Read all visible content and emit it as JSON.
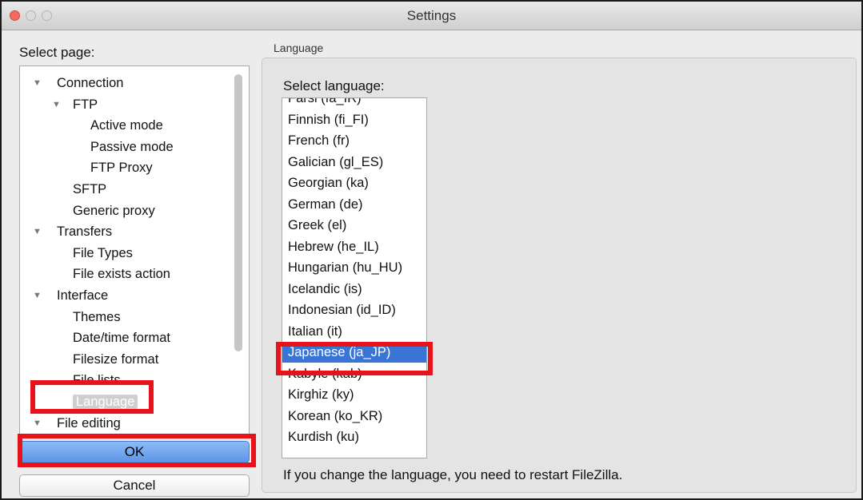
{
  "window": {
    "title": "Settings"
  },
  "left": {
    "select_page_label": "Select page:",
    "tree": [
      {
        "label": "Connection",
        "level": 0,
        "expanded": true
      },
      {
        "label": "FTP",
        "level": 1,
        "expanded": true
      },
      {
        "label": "Active mode",
        "level": 2
      },
      {
        "label": "Passive mode",
        "level": 2
      },
      {
        "label": "FTP Proxy",
        "level": 2
      },
      {
        "label": "SFTP",
        "level": 1
      },
      {
        "label": "Generic proxy",
        "level": 1
      },
      {
        "label": "Transfers",
        "level": 0,
        "expanded": true
      },
      {
        "label": "File Types",
        "level": 1
      },
      {
        "label": "File exists action",
        "level": 1
      },
      {
        "label": "Interface",
        "level": 0,
        "expanded": true
      },
      {
        "label": "Themes",
        "level": 1
      },
      {
        "label": "Date/time format",
        "level": 1
      },
      {
        "label": "Filesize format",
        "level": 1
      },
      {
        "label": "File lists",
        "level": 1
      },
      {
        "label": "Language",
        "level": 1,
        "selected": true
      },
      {
        "label": "File editing",
        "level": 0,
        "expanded": true
      }
    ],
    "ok_label": "OK",
    "cancel_label": "Cancel"
  },
  "right": {
    "group_label": "Language",
    "select_language_label": "Select language:",
    "languages": [
      "Farsi (fa_IR)",
      "Finnish (fi_FI)",
      "French (fr)",
      "Galician (gl_ES)",
      "Georgian (ka)",
      "German (de)",
      "Greek (el)",
      "Hebrew (he_IL)",
      "Hungarian (hu_HU)",
      "Icelandic (is)",
      "Indonesian (id_ID)",
      "Italian (it)",
      "Japanese (ja_JP)",
      "Kabyle (kab)",
      "Kirghiz (ky)",
      "Korean (ko_KR)",
      "Kurdish (ku)"
    ],
    "selected_language": "Japanese (ja_JP)",
    "restart_note": "If you change the language, you need to restart FileZilla."
  },
  "colors": {
    "annotation": "#e8121b",
    "selection": "#3875d7",
    "ok_button": "#6fa3ec"
  }
}
